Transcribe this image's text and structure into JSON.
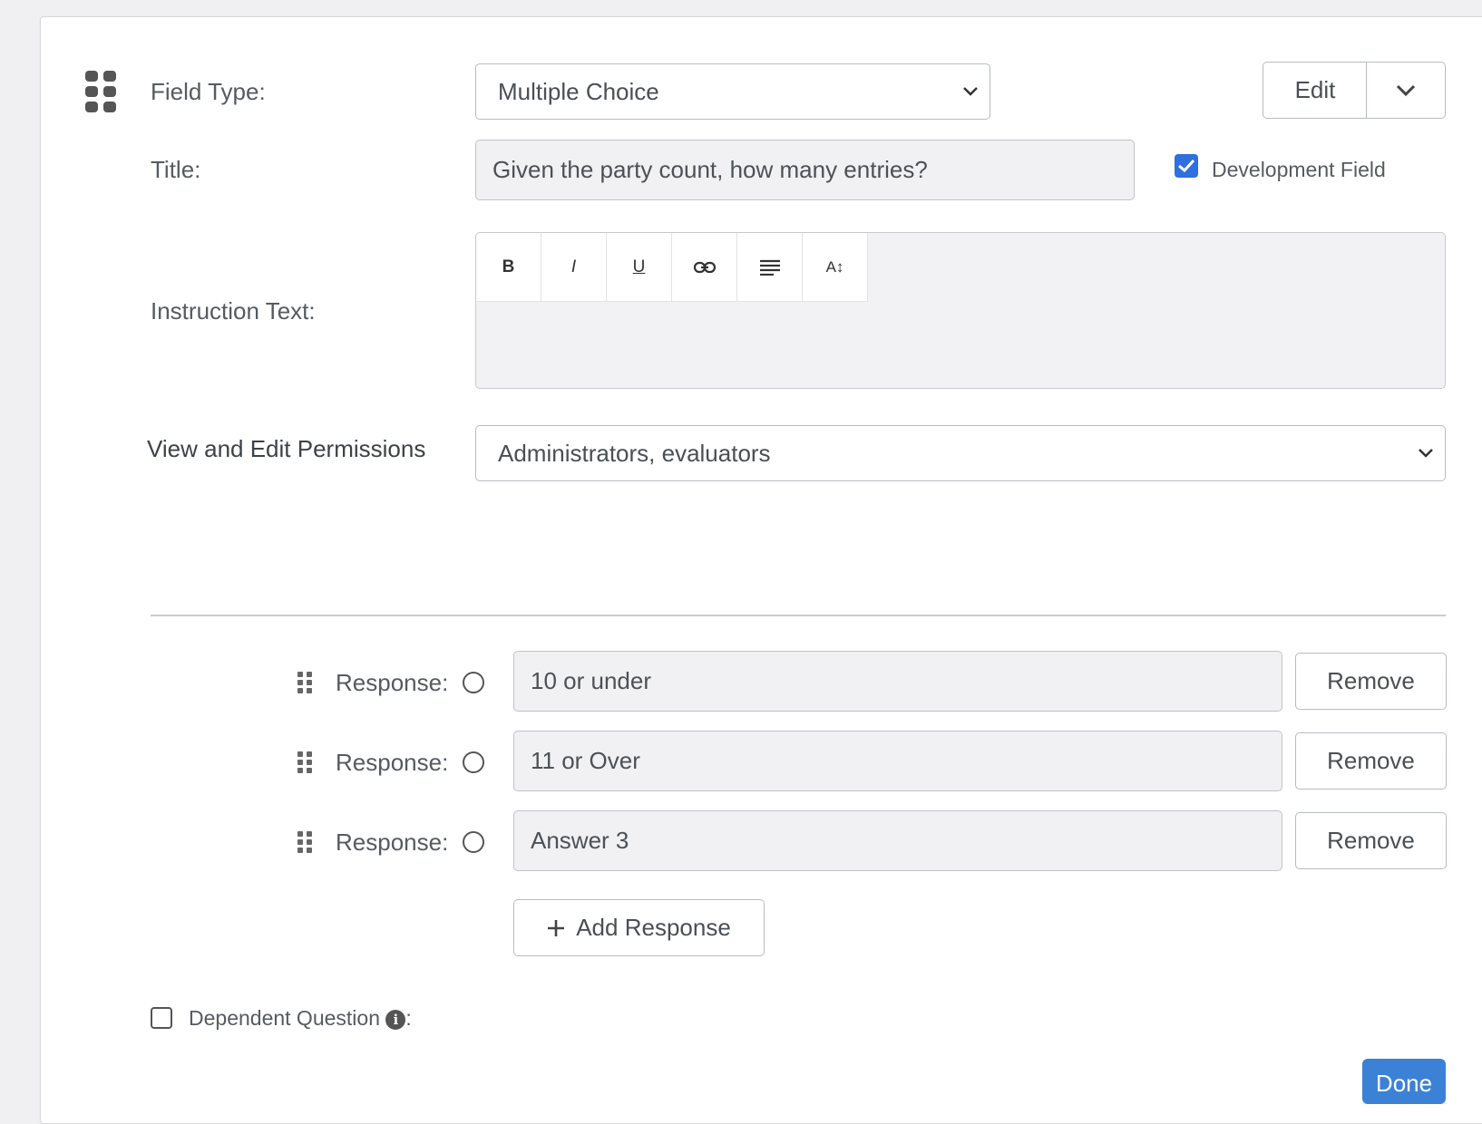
{
  "form": {
    "field_type_label": "Field Type:",
    "field_type_value": "Multiple Choice",
    "edit_label": "Edit",
    "title_label": "Title:",
    "title_value": "Given the party count, how many entries?",
    "development_field_label": "Development Field",
    "development_field_checked": true,
    "instruction_label": "Instruction Text:",
    "toolbar": {
      "bold": "B",
      "italic": "I",
      "underline": "U",
      "font_size": "A↕"
    },
    "permissions_label": "View and Edit Permissions",
    "permissions_value": "Administrators, evaluators"
  },
  "responses": [
    {
      "label": "Response:",
      "value": "10 or under",
      "remove": "Remove"
    },
    {
      "label": "Response:",
      "value": "11 or Over",
      "remove": "Remove"
    },
    {
      "label": "Response:",
      "value": "Answer 3",
      "remove": "Remove"
    }
  ],
  "add_response_label": "Add Response",
  "dependent_question_label": "Dependent Question",
  "dependent_question_suffix": ":",
  "done_label": "Done",
  "colors": {
    "accent": "#2f6fde",
    "done": "#3b82d6"
  }
}
